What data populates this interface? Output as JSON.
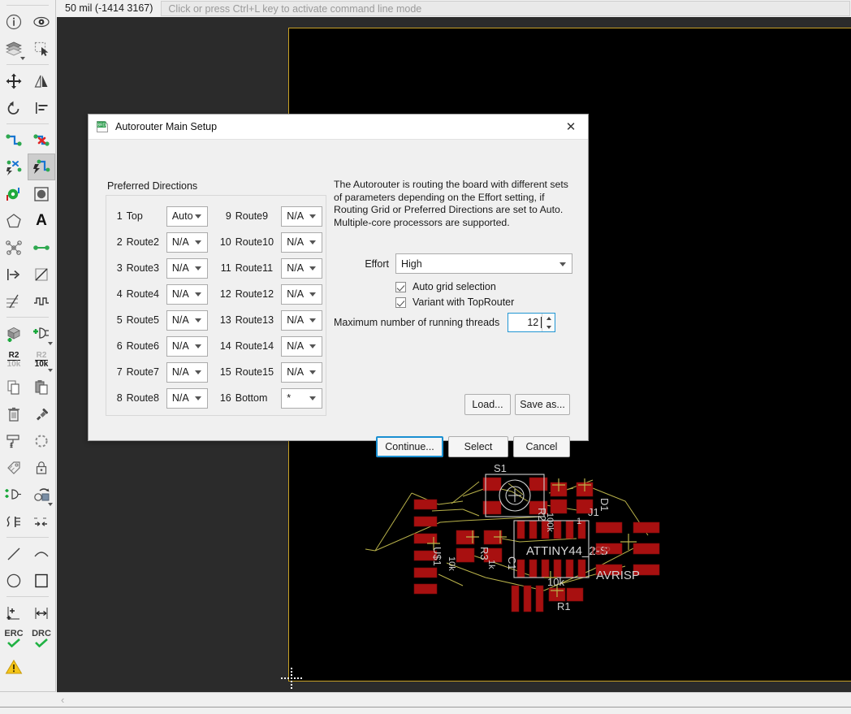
{
  "topbar": {
    "coordinates": "50 mil (-1414 3167)",
    "command_placeholder": "Click or press Ctrl+L key to activate command line mode"
  },
  "toolbar": {
    "items": [
      {
        "name": "info-icon",
        "label": ""
      },
      {
        "name": "show-icon",
        "label": ""
      },
      {
        "name": "layers-icon",
        "label": ""
      },
      {
        "name": "group-select-icon",
        "label": ""
      },
      {
        "name": "move-icon",
        "label": ""
      },
      {
        "name": "mirror-icon",
        "label": ""
      },
      {
        "name": "rotate-icon",
        "label": ""
      },
      {
        "name": "align-icon",
        "label": ""
      },
      {
        "name": "route-icon",
        "label": ""
      },
      {
        "name": "ripup-icon",
        "label": ""
      },
      {
        "name": "autoroute-off-icon",
        "label": ""
      },
      {
        "name": "autoroute-icon",
        "label": ""
      },
      {
        "name": "via-icon",
        "label": ""
      },
      {
        "name": "polygon-pour-icon",
        "label": ""
      },
      {
        "name": "polygon-icon",
        "label": ""
      },
      {
        "name": "text-icon",
        "label": "A"
      },
      {
        "name": "ratsnest-icon",
        "label": ""
      },
      {
        "name": "wire-net-icon",
        "label": ""
      },
      {
        "name": "signal-icon",
        "label": ""
      },
      {
        "name": "miter-icon",
        "label": ""
      },
      {
        "name": "split-icon",
        "label": ""
      },
      {
        "name": "meander-icon",
        "label": ""
      },
      {
        "name": "add-package-icon",
        "label": ""
      },
      {
        "name": "add-part-icon",
        "label": ""
      },
      {
        "name": "name-icon",
        "label": "R2"
      },
      {
        "name": "value-icon",
        "label": "10k"
      },
      {
        "name": "copy-icon",
        "label": ""
      },
      {
        "name": "paste-icon",
        "label": ""
      },
      {
        "name": "delete-icon",
        "label": ""
      },
      {
        "name": "change-icon",
        "label": ""
      },
      {
        "name": "paint-icon",
        "label": ""
      },
      {
        "name": "optimize-icon",
        "label": ""
      },
      {
        "name": "attribute-icon",
        "label": ""
      },
      {
        "name": "lock-icon",
        "label": ""
      },
      {
        "name": "add-gate-icon",
        "label": ""
      },
      {
        "name": "replace-icon",
        "label": ""
      },
      {
        "name": "swap-icon",
        "label": ""
      },
      {
        "name": "pin-swap-icon",
        "label": ""
      },
      {
        "name": "line-icon",
        "label": ""
      },
      {
        "name": "arc-icon",
        "label": ""
      },
      {
        "name": "circle-icon",
        "label": ""
      },
      {
        "name": "rectangle-icon",
        "label": ""
      },
      {
        "name": "dimension-icon",
        "label": ""
      },
      {
        "name": "measure-icon",
        "label": ""
      },
      {
        "name": "erc-icon",
        "label": "ERC"
      },
      {
        "name": "drc-icon",
        "label": "DRC"
      },
      {
        "name": "errors-icon",
        "label": ""
      }
    ],
    "name_label_top": "R2",
    "name_label_bottom": "10k",
    "value_label_top": "R2",
    "value_label_bottom": "10k",
    "erc_label": "ERC",
    "drc_label": "DRC",
    "text_tool_label": "A"
  },
  "dialog": {
    "title": "Autorouter Main Setup",
    "close_label": "✕",
    "preferred_directions_label": "Preferred Directions",
    "description": "The Autorouter is routing the board with different sets of parameters depending on the Effort setting, if Routing Grid or Preferred Directions are set to Auto. Multiple-core processors are supported.",
    "effort_label": "Effort",
    "effort_value": "High",
    "checkboxes": [
      {
        "label": "Auto grid selection",
        "checked": true
      },
      {
        "label": "Variant with TopRouter",
        "checked": true
      }
    ],
    "threads_label": "Maximum number of running threads",
    "threads_value": "12",
    "layers_left": [
      {
        "num": "1",
        "name": "Top",
        "value": "Auto"
      },
      {
        "num": "2",
        "name": "Route2",
        "value": "N/A"
      },
      {
        "num": "3",
        "name": "Route3",
        "value": "N/A"
      },
      {
        "num": "4",
        "name": "Route4",
        "value": "N/A"
      },
      {
        "num": "5",
        "name": "Route5",
        "value": "N/A"
      },
      {
        "num": "6",
        "name": "Route6",
        "value": "N/A"
      },
      {
        "num": "7",
        "name": "Route7",
        "value": "N/A"
      },
      {
        "num": "8",
        "name": "Route8",
        "value": "N/A"
      }
    ],
    "layers_right": [
      {
        "num": "9",
        "name": "Route9",
        "value": "N/A"
      },
      {
        "num": "10",
        "name": "Route10",
        "value": "N/A"
      },
      {
        "num": "11",
        "name": "Route11",
        "value": "N/A"
      },
      {
        "num": "12",
        "name": "Route12",
        "value": "N/A"
      },
      {
        "num": "13",
        "name": "Route13",
        "value": "N/A"
      },
      {
        "num": "14",
        "name": "Route14",
        "value": "N/A"
      },
      {
        "num": "15",
        "name": "Route15",
        "value": "N/A"
      },
      {
        "num": "16",
        "name": "Bottom",
        "value": "*"
      }
    ],
    "buttons": {
      "load": "Load...",
      "save_as": "Save as...",
      "continue": "Continue...",
      "select": "Select",
      "cancel": "Cancel"
    }
  },
  "board": {
    "background": "#000000",
    "outline_color": "#c9a227",
    "pad_color": "#a81010",
    "airwire_color": "#b9b24a",
    "silk_color": "#d6d6d6",
    "labels": [
      "S1",
      "R2",
      "100k",
      "D1",
      "U$1",
      "10k",
      "R3",
      "1k",
      "C1",
      "ATTINY44_2-S",
      "J1",
      "1",
      "ISP",
      "AVRISP",
      "10k",
      "R1"
    ]
  },
  "scroll": {
    "left_arrow": "‹"
  }
}
